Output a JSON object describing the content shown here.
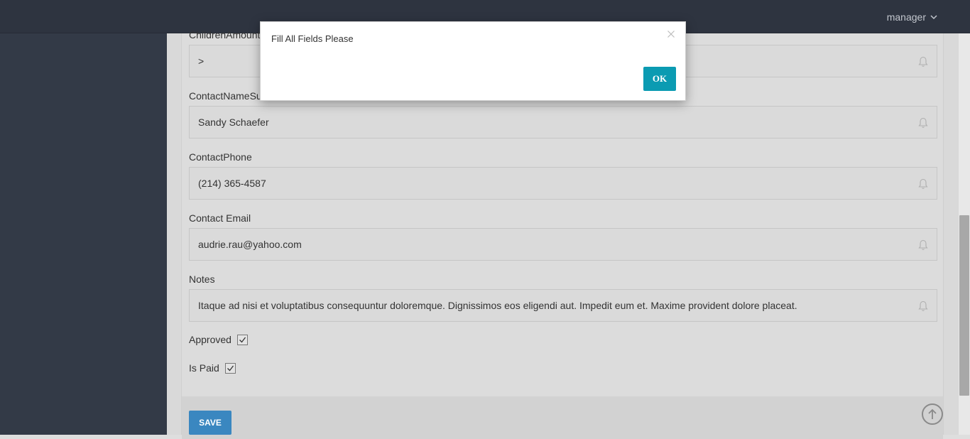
{
  "header": {
    "user_label": "manager",
    "user_menu_icon": "chevron-down-icon"
  },
  "form": {
    "fields": [
      {
        "label": "ChildrenAmount",
        "value": ">"
      },
      {
        "label": "ContactNameSurname",
        "value": "Sandy Schaefer"
      },
      {
        "label": "ContactPhone",
        "value": "(214) 365-4587"
      },
      {
        "label": "Contact Email",
        "value": "audrie.rau@yahoo.com"
      },
      {
        "label": "Notes",
        "value": "Itaque ad nisi et voluptatibus consequuntur doloremque. Dignissimos eos eligendi aut. Impedit eum et. Maxime provident dolore placeat."
      }
    ],
    "checkboxes": [
      {
        "label": "Approved",
        "checked": true
      },
      {
        "label": "Is Paid",
        "checked": true
      }
    ],
    "save_label": "SAVE"
  },
  "modal": {
    "message": "Fill All Fields Please",
    "ok_label": "OK",
    "close_icon": "close-icon"
  },
  "colors": {
    "topbar": "#2e3440",
    "sidebar": "#333a47",
    "save_button": "#3a87c0",
    "ok_button": "#0b9bb2"
  }
}
